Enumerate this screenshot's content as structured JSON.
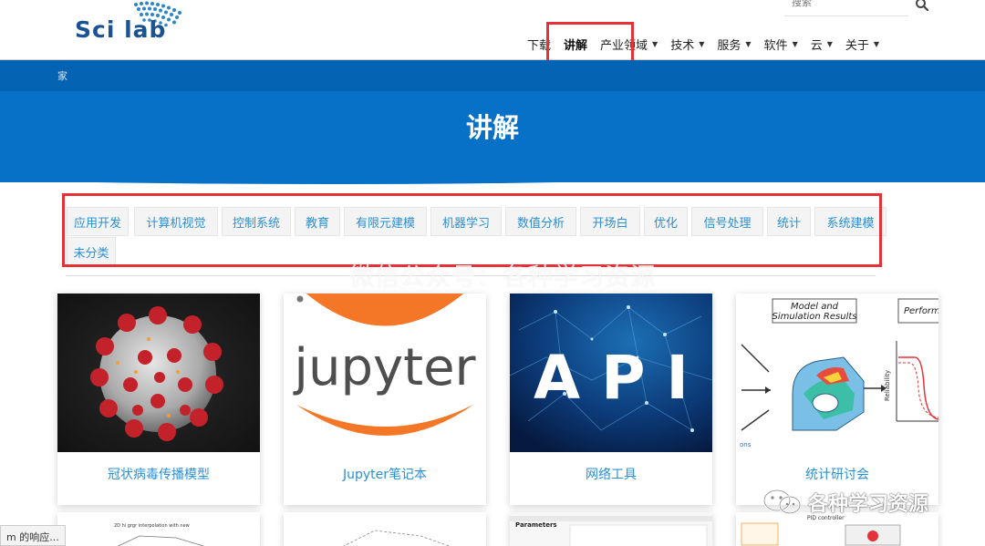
{
  "header": {
    "logo_text": "Sci lab",
    "search_placeholder": "搜索",
    "nav": [
      {
        "label": "下载",
        "caret": false,
        "active": false
      },
      {
        "label": "讲解",
        "caret": false,
        "active": true
      },
      {
        "label": "产业领域",
        "caret": true,
        "active": false
      },
      {
        "label": "技术",
        "caret": true,
        "active": false
      },
      {
        "label": "服务",
        "caret": true,
        "active": false
      },
      {
        "label": "软件",
        "caret": true,
        "active": false
      },
      {
        "label": "云",
        "caret": true,
        "active": false
      },
      {
        "label": "关于",
        "caret": true,
        "active": false
      }
    ]
  },
  "breadcrumb": "家",
  "page_title": "讲解",
  "categories": [
    "应用开发",
    "计算机视觉",
    "控制系统",
    "教育",
    "有限元建模",
    "机器学习",
    "数值分析",
    "开场白",
    "优化",
    "信号处理",
    "统计",
    "系统建模",
    "未分类"
  ],
  "watermark_center": "微信公众号：各种学习资源",
  "cards": [
    {
      "title": "冠状病毒传播模型",
      "image": "coronavirus-image"
    },
    {
      "title": "Jupyter笔记本",
      "image": "jupyter-logo-image"
    },
    {
      "title": "网络工具",
      "image": "api-network-image"
    },
    {
      "title": "统计研讨会",
      "image": "reliability-model-image",
      "image_texts": {
        "a": "Model and",
        "b": "Simulation Results",
        "c": "Perform",
        "d": "Reliability",
        "e": "ons"
      }
    }
  ],
  "jupyter_word": "jupyter",
  "api_word": "A P I",
  "lower_cards": [
    {
      "text": "2D hi grgr interpolation with new"
    },
    {
      "text": ""
    },
    {
      "text": "Parameters"
    },
    {
      "text": "PID controller"
    }
  ],
  "status_tip": "m 的响应...",
  "wechat_watermark": "各种学习资源",
  "colors": {
    "brand_blue": "#0671c6",
    "link_blue": "#2a8fd4",
    "highlight_red": "#e53238"
  }
}
